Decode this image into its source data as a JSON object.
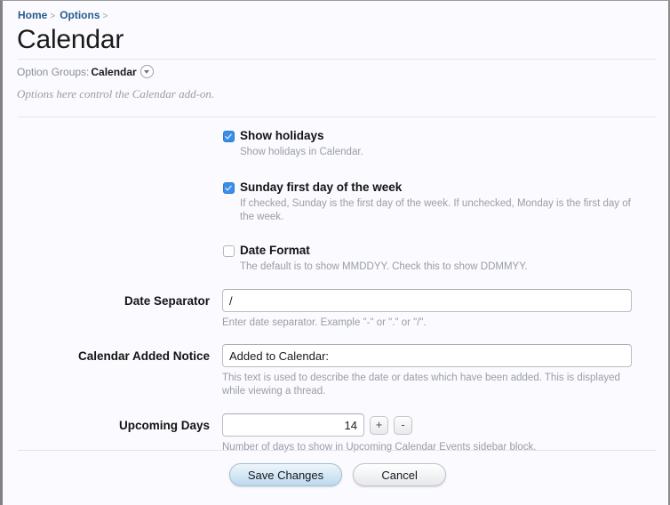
{
  "breadcrumb": {
    "items": [
      {
        "label": "Home",
        "separator": ">"
      },
      {
        "label": "Options",
        "separator": ">"
      }
    ]
  },
  "header": {
    "title": "Calendar",
    "option_groups_label": "Option Groups:",
    "option_groups_value": "Calendar",
    "dropdown_icon": "chevron-down-circle-icon",
    "description": "Options here control the Calendar add-on."
  },
  "form": {
    "checkboxes": [
      {
        "label": "Show holidays",
        "checked": true,
        "hint": "Show holidays in Calendar."
      },
      {
        "label": "Sunday first day of the week",
        "checked": true,
        "hint": "If checked, Sunday is the first day of the week. If unchecked, Monday is the first day of the week."
      },
      {
        "label": "Date Format",
        "checked": false,
        "hint": "The default is to show MMDDYY. Check this to show DDMMYY."
      }
    ],
    "fields": [
      {
        "label": "Date Separator",
        "value": "/",
        "placeholder": "",
        "hint": "Enter date separator. Example \"-\" or \".\" or \"/\"."
      },
      {
        "label": "Calendar Added Notice",
        "value": "Added to Calendar:",
        "placeholder": "",
        "hint": "This text is used to describe the date or dates which have been added. This is displayed while viewing a thread."
      }
    ],
    "stepper": {
      "label": "Upcoming Days",
      "value": "14",
      "increment_label": "+",
      "decrement_label": "-",
      "hint": "Number of days to show in Upcoming Calendar Events sidebar block."
    }
  },
  "actions": {
    "save_label": "Save Changes",
    "cancel_label": "Cancel"
  },
  "colors": {
    "link": "#2a5b8c",
    "checkbox_accent": "#3b8ee8",
    "hint_text": "#9a9ea6",
    "page_background": "#fafaff"
  }
}
